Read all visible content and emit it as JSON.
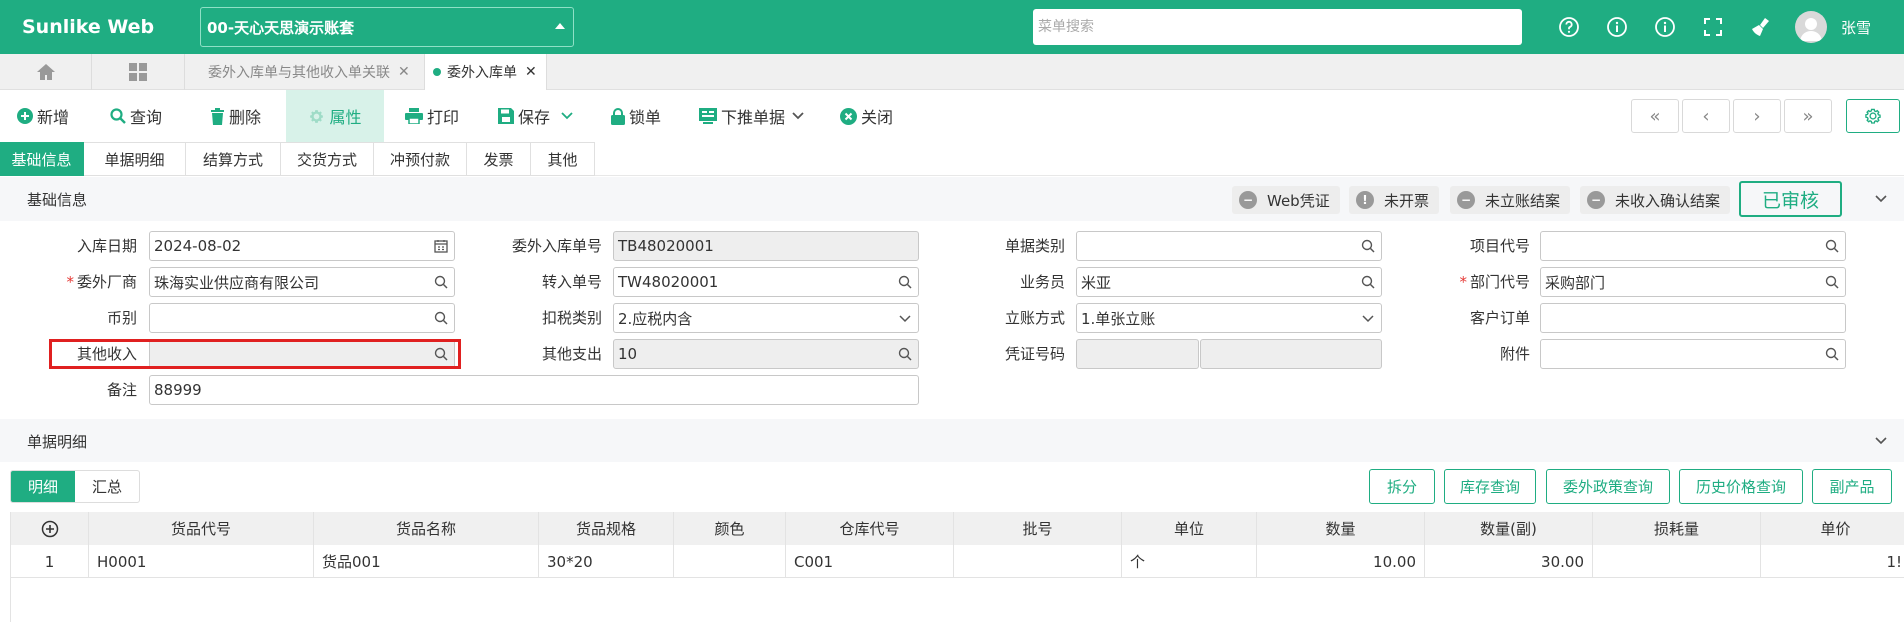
{
  "app": {
    "brand": "Sunlike Web",
    "account": "00-天心天思演示账套",
    "search_placeholder": "菜单搜索",
    "user": "张雪"
  },
  "tabs": [
    {
      "label": "委外入库单与其他收入单关联",
      "active": false
    },
    {
      "label": "委外入库单",
      "active": true
    }
  ],
  "toolbar": {
    "new": "新增",
    "query": "查询",
    "delete": "删除",
    "props": "属性",
    "print": "打印",
    "save": "保存",
    "lock": "锁单",
    "push": "下推单据",
    "close": "关闭"
  },
  "nav": {
    "first": "«",
    "prev": "‹",
    "next": "›",
    "last": "»"
  },
  "section_tabs": [
    "基础信息",
    "单据明细",
    "结算方式",
    "交货方式",
    "冲预付款",
    "发票",
    "其他"
  ],
  "basic_section": {
    "title": "基础信息",
    "badges": [
      "Web凭证",
      "未开票",
      "未立账结案",
      "未收入确认结案"
    ],
    "status": "已审核"
  },
  "form": {
    "inbound_date": {
      "label": "入库日期",
      "value": "2024-08-02"
    },
    "vendor": {
      "label": "委外厂商",
      "value": "珠海实业供应商有限公司"
    },
    "currency": {
      "label": "币别",
      "value": ""
    },
    "other_income": {
      "label": "其他收入",
      "value": ""
    },
    "remark": {
      "label": "备注",
      "value": "88999"
    },
    "order_no": {
      "label": "委外入库单号",
      "value": "TB48020001"
    },
    "transfer_no": {
      "label": "转入单号",
      "value": "TW48020001"
    },
    "tax_type": {
      "label": "扣税类别",
      "value": "2.应税内含"
    },
    "other_expense": {
      "label": "其他支出",
      "value": "10"
    },
    "doc_type": {
      "label": "单据类别",
      "value": ""
    },
    "salesman": {
      "label": "业务员",
      "value": "米亚"
    },
    "account_mode": {
      "label": "立账方式",
      "value": "1.单张立账"
    },
    "voucher_no": {
      "label": "凭证号码",
      "value": ""
    },
    "project_code": {
      "label": "项目代号",
      "value": ""
    },
    "dept_code": {
      "label": "部门代号",
      "value": "采购部门"
    },
    "customer_order": {
      "label": "客户订单",
      "value": ""
    },
    "attachment": {
      "label": "附件",
      "value": ""
    }
  },
  "detail_section": {
    "title": "单据明细"
  },
  "detail_tools": {
    "seg": [
      "明细",
      "汇总"
    ],
    "buttons": [
      "拆分",
      "库存查询",
      "委外政策查询",
      "历史价格查询",
      "副产品"
    ]
  },
  "grid": {
    "headers": [
      "货品代号",
      "货品名称",
      "货品规格",
      "颜色",
      "仓库代号",
      "批号",
      "单位",
      "数量",
      "数量(副)",
      "损耗量",
      "单价"
    ],
    "rows": [
      {
        "no": "1",
        "code": "H0001",
        "name": "货品001",
        "spec": "30*20",
        "color": "",
        "wh": "C001",
        "batch": "",
        "unit": "个",
        "qty": "10.00",
        "qty2": "30.00",
        "loss": "",
        "price": "1!"
      }
    ]
  }
}
